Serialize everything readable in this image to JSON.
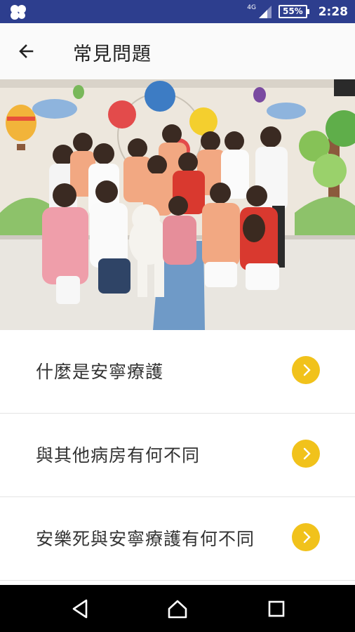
{
  "status_bar": {
    "network": "4G",
    "battery": "55%",
    "time": "2:28",
    "app_icon": "app-notification-icon",
    "signal_icon": "signal-icon",
    "background_color": "#2d3e8e"
  },
  "app_bar": {
    "title": "常見問題",
    "back_icon": "back-arrow-icon"
  },
  "hero": {
    "description": "group-photo"
  },
  "faq": {
    "items": [
      {
        "label": "什麼是安寧療護"
      },
      {
        "label": "與其他病房有何不同"
      },
      {
        "label": "安樂死與安寧療護有何不同"
      }
    ],
    "chevron_icon": "chevron-right-icon",
    "chevron_color": "#f1c21b"
  },
  "nav_bar": {
    "back_icon": "nav-back-icon",
    "home_icon": "nav-home-icon",
    "recents_icon": "nav-recents-icon"
  }
}
